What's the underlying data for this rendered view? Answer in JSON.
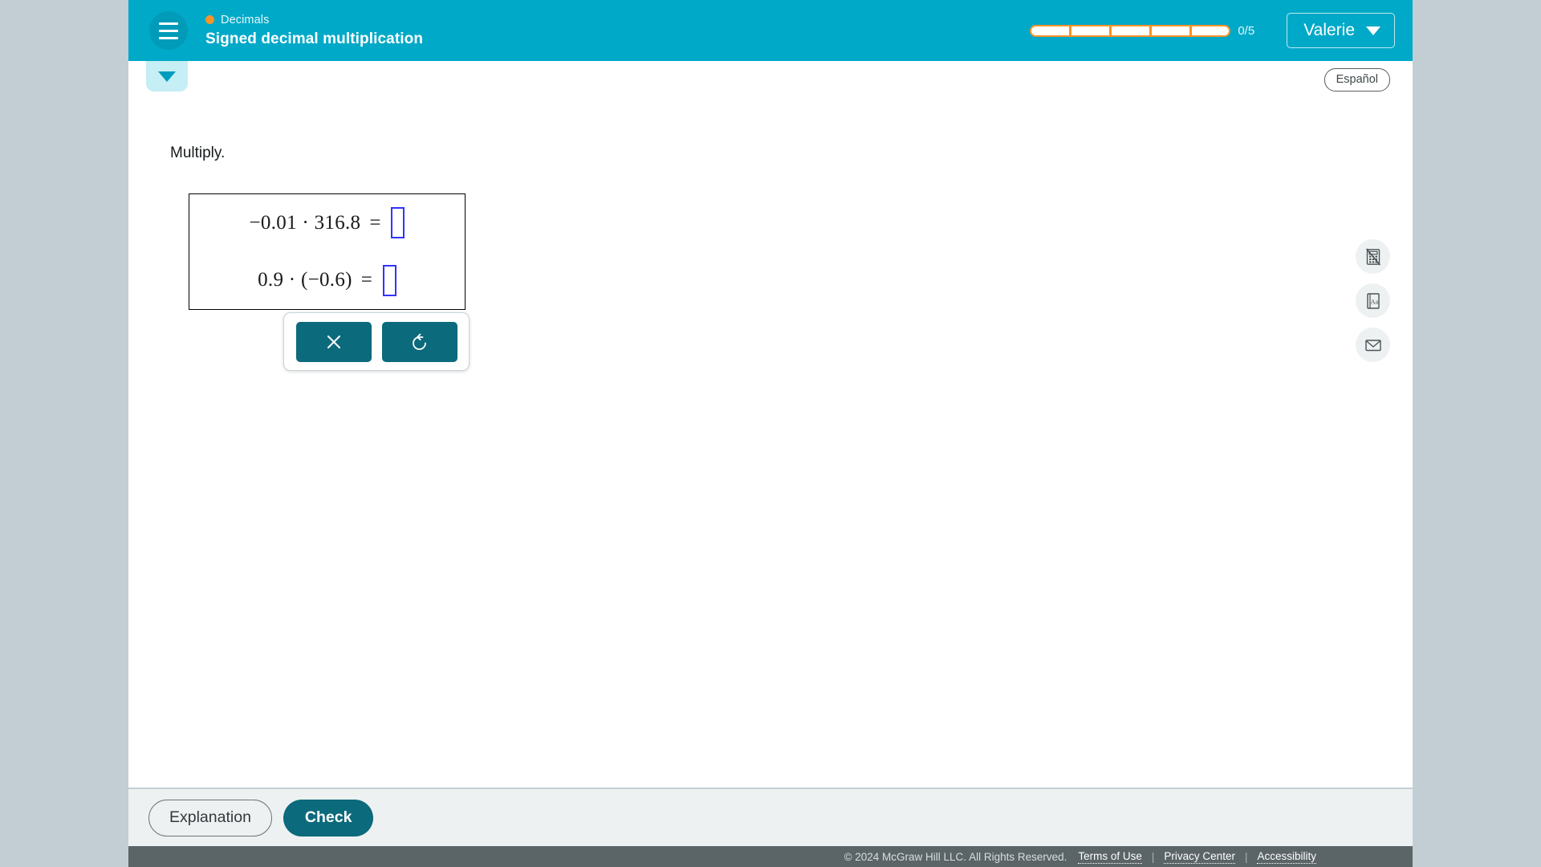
{
  "header": {
    "menu_icon": "hamburger-menu-icon",
    "topic": "Decimals",
    "lesson_title": "Signed decimal multiplication",
    "progress": {
      "total_segments": 5,
      "filled_segments": 0,
      "count_label": "0/5"
    },
    "user": {
      "name": "Valerie",
      "chevron_icon": "chevron-down-icon"
    },
    "accent_color": "#00a9c8",
    "progress_color": "#f79428"
  },
  "content": {
    "collapse_tab_icon": "chevron-down-icon",
    "espanol_label": "Español",
    "instruction": "Multiply.",
    "problem": {
      "rows": [
        {
          "expression": "−0.01 · 316.8",
          "left_operand": "−0.01",
          "operator": "·",
          "right_operand": "316.8",
          "equals": "=",
          "answer": ""
        },
        {
          "expression": "0.9 · (−0.6)",
          "left_operand": "0.9",
          "operator": "·",
          "right_operand": "(−0.6)",
          "equals": "=",
          "answer": ""
        }
      ]
    },
    "mini_toolbar": {
      "buttons": [
        {
          "name": "clear-button",
          "icon": "close-x-icon"
        },
        {
          "name": "undo-button",
          "icon": "undo-arrow-icon"
        }
      ]
    },
    "right_rail": [
      {
        "name": "calculator-disabled-button",
        "icon": "calculator-slashed-icon"
      },
      {
        "name": "glossary-button",
        "icon": "book-aa-icon"
      },
      {
        "name": "message-button",
        "icon": "envelope-icon"
      }
    ]
  },
  "actions": {
    "explanation_label": "Explanation",
    "check_label": "Check",
    "check_color": "#0b6a7c"
  },
  "footer": {
    "copyright": "© 2024 McGraw Hill LLC. All Rights Reserved.",
    "links": [
      "Terms of Use",
      "Privacy Center",
      "Accessibility"
    ],
    "separator": "|"
  }
}
